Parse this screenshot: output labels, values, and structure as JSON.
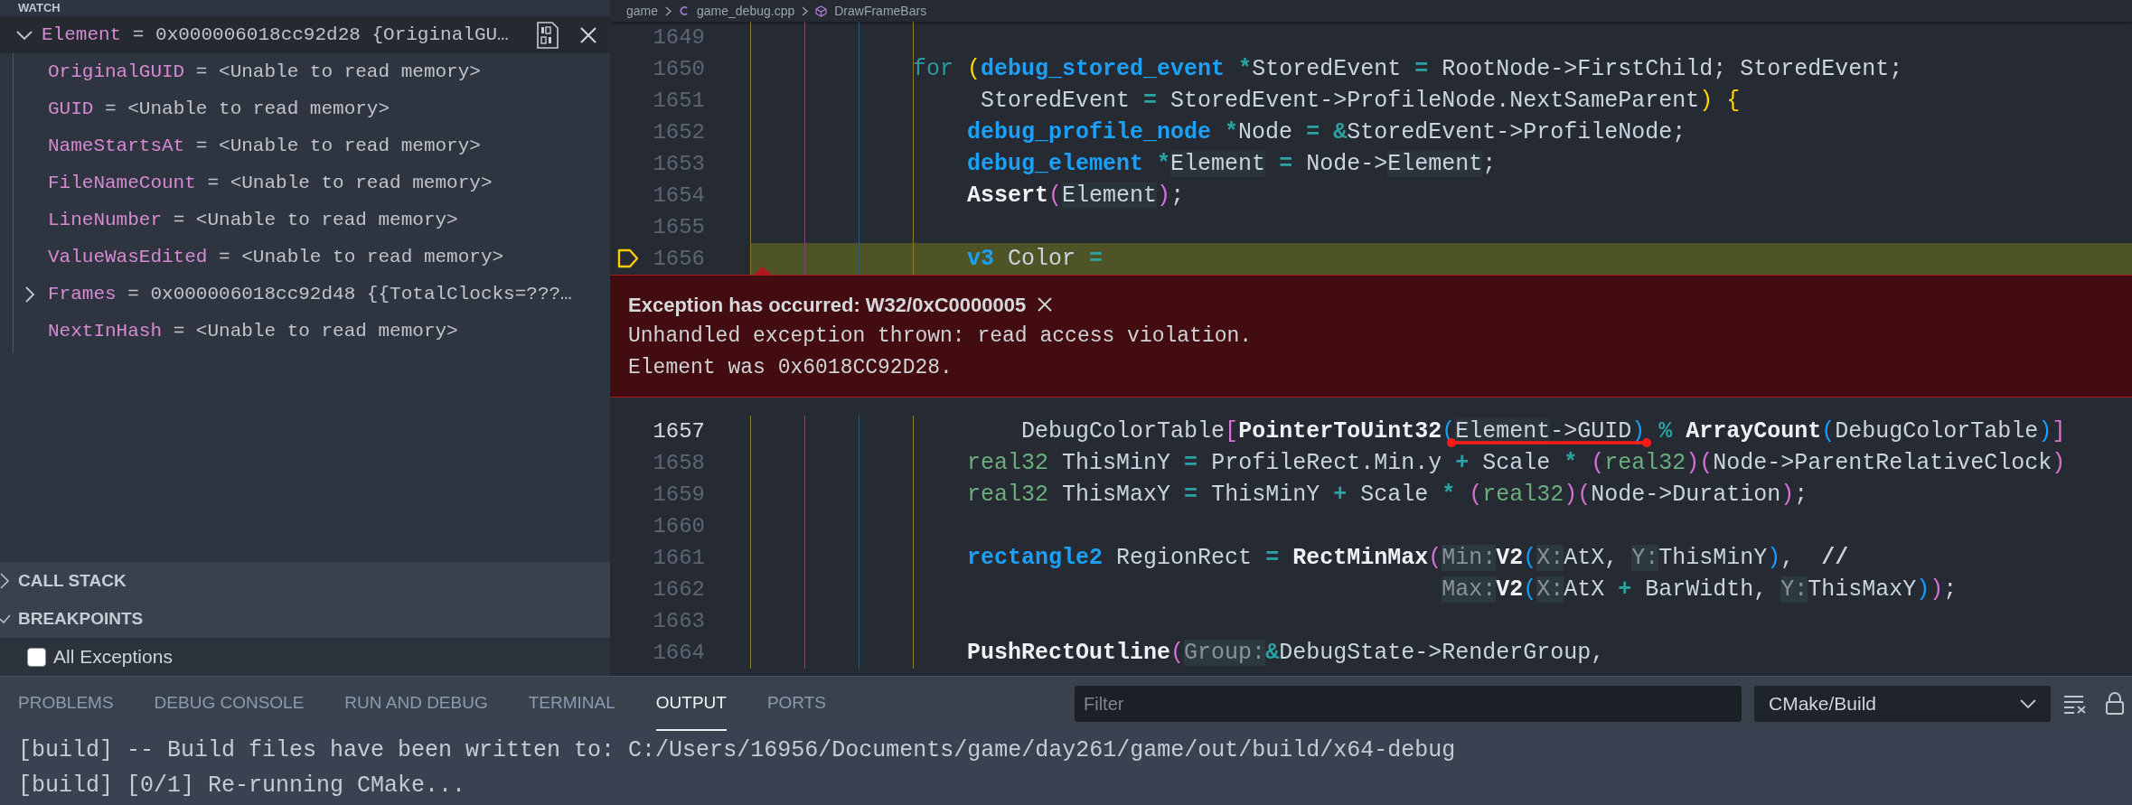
{
  "sidebar": {
    "watch": {
      "title": "WATCH",
      "items": [
        {
          "name": "Element",
          "value": "= 0x000006018cc92d28 {OriginalGU…",
          "expanded": true,
          "selected": true,
          "children": [
            {
              "name": "OriginalGUID",
              "value": "= <Unable to read memory>",
              "selected": false
            },
            {
              "name": "GUID",
              "value": "= <Unable to read memory>",
              "selected": false
            },
            {
              "name": "NameStartsAt",
              "value": "= <Unable to read memory>",
              "selected": false
            },
            {
              "name": "FileNameCount",
              "value": "= <Unable to read memory>",
              "selected": false
            },
            {
              "name": "LineNumber",
              "value": "= <Unable to read memory>",
              "selected": false
            },
            {
              "name": "ValueWasEdited",
              "value": "= <Unable to read memory>",
              "selected": false
            },
            {
              "name": "Frames",
              "value": "= 0x000006018cc92d48 {{TotalClocks=???…",
              "expanded": false,
              "selected": false
            },
            {
              "name": "NextInHash",
              "value": "= <Unable to read memory>",
              "selected": false
            }
          ]
        }
      ]
    },
    "sections": [
      {
        "title": "CALL STACK",
        "expanded": false
      },
      {
        "title": "BREAKPOINTS",
        "expanded": true,
        "items": [
          {
            "label": "All Exceptions",
            "checked": false
          }
        ]
      }
    ]
  },
  "editor": {
    "breadcrumb": [
      "game",
      "game_debug.cpp",
      "DrawFrameBars"
    ],
    "lines_before": [
      {
        "number": "1649",
        "highlighted": false,
        "active": false,
        "paused": false
      },
      {
        "number": "1650",
        "highlighted": false,
        "active": false,
        "paused": false,
        "tokens": [
          {
            "kind": "keyword",
            "text": "            for "
          },
          {
            "kind": "bracket1",
            "text": "("
          },
          {
            "kind": "type",
            "text": "debug_stored_event "
          },
          {
            "kind": "op",
            "text": "*"
          },
          {
            "kind": "plain",
            "text": "StoredEvent "
          },
          {
            "kind": "op",
            "text": "="
          },
          {
            "kind": "plain",
            "text": " RootNode->FirstChild; StoredEvent;"
          }
        ]
      },
      {
        "number": "1651",
        "highlighted": false,
        "active": false,
        "paused": false,
        "tokens": [
          {
            "kind": "plain",
            "text": "                 StoredEvent "
          },
          {
            "kind": "op",
            "text": "="
          },
          {
            "kind": "plain",
            "text": " StoredEvent->ProfileNode.NextSameParent"
          },
          {
            "kind": "bracket1",
            "text": ") {"
          }
        ]
      },
      {
        "number": "1652",
        "highlighted": false,
        "active": false,
        "paused": false,
        "tokens": [
          {
            "kind": "type",
            "text": "                debug_profile_node "
          },
          {
            "kind": "op",
            "text": "*"
          },
          {
            "kind": "plain",
            "text": "Node "
          },
          {
            "kind": "op",
            "text": "= &"
          },
          {
            "kind": "plain",
            "text": "StoredEvent->ProfileNode;"
          }
        ]
      },
      {
        "number": "1653",
        "highlighted": false,
        "active": false,
        "paused": false,
        "tokens": [
          {
            "kind": "type",
            "text": "                debug_element "
          },
          {
            "kind": "op",
            "text": "*"
          },
          {
            "kind": "ref",
            "text": "Element"
          },
          {
            "kind": "op",
            "text": " = "
          },
          {
            "kind": "plain",
            "text": "Node->"
          },
          {
            "kind": "ref",
            "text": "Element"
          },
          {
            "kind": "plain",
            "text": ";"
          }
        ]
      },
      {
        "number": "1654",
        "highlighted": false,
        "active": false,
        "paused": false,
        "tokens": [
          {
            "kind": "func",
            "text": "                Assert"
          },
          {
            "kind": "bracket2",
            "text": "("
          },
          {
            "kind": "ref",
            "text": "Element"
          },
          {
            "kind": "bracket2",
            "text": ")"
          },
          {
            "kind": "plain",
            "text": ";"
          }
        ]
      },
      {
        "number": "1655",
        "highlighted": false,
        "active": false,
        "paused": false
      },
      {
        "number": "1656",
        "highlighted": true,
        "active": false,
        "paused": true,
        "tokens": [
          {
            "kind": "type",
            "text": "                v3"
          },
          {
            "kind": "plain",
            "text": " Color "
          },
          {
            "kind": "op",
            "text": "="
          }
        ]
      }
    ],
    "exception": {
      "title": "Exception has occurred: W32/0xC0000005",
      "messages": [
        "Unhandled exception thrown: read access violation.",
        "Element was 0x6018CC92D28."
      ]
    },
    "lines_after": [
      {
        "number": "1657",
        "highlighted": false,
        "active": true,
        "paused": false,
        "tokens": [
          {
            "kind": "plain",
            "text": "                    DebugColorTable"
          },
          {
            "kind": "bracket2",
            "text": "["
          },
          {
            "kind": "func",
            "text": "PointerToUint32"
          },
          {
            "kind": "bracket3",
            "text": "("
          },
          {
            "kind": "ref",
            "text": "Element"
          },
          {
            "kind": "plain",
            "text": "->GUID"
          },
          {
            "kind": "bracket3",
            "text": ")"
          },
          {
            "kind": "op",
            "text": " % "
          },
          {
            "kind": "func",
            "text": "ArrayCount"
          },
          {
            "kind": "bracket3",
            "text": "("
          },
          {
            "kind": "plain",
            "text": "DebugColorTable"
          },
          {
            "kind": "bracket3",
            "text": ")"
          },
          {
            "kind": "bracket2",
            "text": "]"
          }
        ]
      },
      {
        "number": "1658",
        "highlighted": false,
        "active": false,
        "paused": false,
        "tokens": [
          {
            "kind": "prim",
            "text": "                real32"
          },
          {
            "kind": "plain",
            "text": " ThisMinY "
          },
          {
            "kind": "op",
            "text": "="
          },
          {
            "kind": "plain",
            "text": " ProfileRect.Min.y "
          },
          {
            "kind": "op",
            "text": "+"
          },
          {
            "kind": "plain",
            "text": " Scale "
          },
          {
            "kind": "op",
            "text": "* "
          },
          {
            "kind": "bracket2",
            "text": "("
          },
          {
            "kind": "prim",
            "text": "real32"
          },
          {
            "kind": "bracket2",
            "text": ")("
          },
          {
            "kind": "plain",
            "text": "Node->ParentRelativeClock"
          },
          {
            "kind": "bracket2",
            "text": ")"
          }
        ]
      },
      {
        "number": "1659",
        "highlighted": false,
        "active": false,
        "paused": false,
        "tokens": [
          {
            "kind": "prim",
            "text": "                real32"
          },
          {
            "kind": "plain",
            "text": " ThisMaxY "
          },
          {
            "kind": "op",
            "text": "="
          },
          {
            "kind": "plain",
            "text": " ThisMinY "
          },
          {
            "kind": "op",
            "text": "+"
          },
          {
            "kind": "plain",
            "text": " Scale "
          },
          {
            "kind": "op",
            "text": "* "
          },
          {
            "kind": "bracket2",
            "text": "("
          },
          {
            "kind": "prim",
            "text": "real32"
          },
          {
            "kind": "bracket2",
            "text": ")("
          },
          {
            "kind": "plain",
            "text": "Node->Duration"
          },
          {
            "kind": "bracket2",
            "text": ")"
          },
          {
            "kind": "plain",
            "text": ";"
          }
        ]
      },
      {
        "number": "1660",
        "highlighted": false,
        "active": false,
        "paused": false
      },
      {
        "number": "1661",
        "highlighted": false,
        "active": false,
        "paused": false,
        "tokens": [
          {
            "kind": "type",
            "text": "                rectangle2"
          },
          {
            "kind": "plain",
            "text": " RegionRect "
          },
          {
            "kind": "op",
            "text": "= "
          },
          {
            "kind": "func",
            "text": "RectMinMax"
          },
          {
            "kind": "bracket2",
            "text": "("
          },
          {
            "kind": "hint",
            "text": "Min:"
          },
          {
            "kind": "func",
            "text": "V2"
          },
          {
            "kind": "bracket3",
            "text": "("
          },
          {
            "kind": "hint",
            "text": "X:"
          },
          {
            "kind": "plain",
            "text": "AtX, "
          },
          {
            "kind": "hint",
            "text": "Y:"
          },
          {
            "kind": "plain",
            "text": "ThisMinY"
          },
          {
            "kind": "bracket3",
            "text": ")"
          },
          {
            "kind": "plain",
            "text": ",  "
          },
          {
            "kind": "comment",
            "text": "//"
          }
        ]
      },
      {
        "number": "1662",
        "highlighted": false,
        "active": false,
        "paused": false,
        "tokens": [
          {
            "kind": "hint",
            "text": "                                                   Max:"
          },
          {
            "kind": "func",
            "text": "V2"
          },
          {
            "kind": "bracket3",
            "text": "("
          },
          {
            "kind": "hint",
            "text": "X:"
          },
          {
            "kind": "plain",
            "text": "AtX "
          },
          {
            "kind": "op",
            "text": "+"
          },
          {
            "kind": "plain",
            "text": " BarWidth, "
          },
          {
            "kind": "hint",
            "text": "Y:"
          },
          {
            "kind": "plain",
            "text": "ThisMaxY"
          },
          {
            "kind": "bracket3",
            "text": ")"
          },
          {
            "kind": "bracket2",
            "text": ")"
          },
          {
            "kind": "plain",
            "text": ";"
          }
        ]
      },
      {
        "number": "1663",
        "highlighted": false,
        "active": false,
        "paused": false
      },
      {
        "number": "1664",
        "highlighted": false,
        "active": false,
        "paused": false,
        "tokens": [
          {
            "kind": "func",
            "text": "                PushRectOutline"
          },
          {
            "kind": "bracket2",
            "text": "("
          },
          {
            "kind": "hint",
            "text": "Group:"
          },
          {
            "kind": "op",
            "text": "&"
          },
          {
            "kind": "plain",
            "text": "DebugState->RenderGroup,"
          }
        ]
      }
    ]
  },
  "panel": {
    "tabs": [
      {
        "label": "PROBLEMS",
        "selected": false
      },
      {
        "label": "DEBUG CONSOLE",
        "selected": false
      },
      {
        "label": "RUN AND DEBUG",
        "selected": false
      },
      {
        "label": "TERMINAL",
        "selected": false
      },
      {
        "label": "OUTPUT",
        "selected": true
      },
      {
        "label": "PORTS",
        "selected": false
      }
    ],
    "filter": {
      "placeholder": "Filter"
    },
    "channel": "CMake/Build",
    "output": [
      "[build] -- Build files have been written to: C:/Users/16956/Documents/game/day261/game/out/build/x64-debug",
      "[build] [0/1] Re-running CMake..."
    ]
  }
}
